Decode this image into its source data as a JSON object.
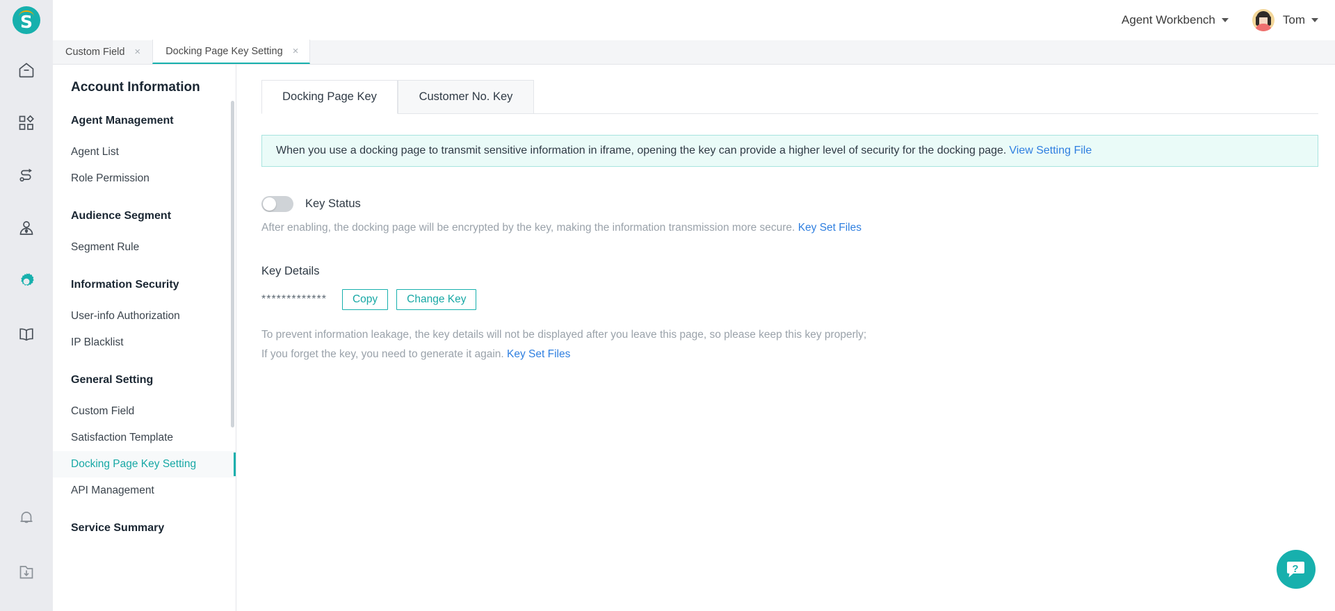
{
  "brand": {
    "logo_letter": "S",
    "accent_color": "#17b0ad",
    "link_color": "#2f7fe0",
    "arc_color": "#f2a900"
  },
  "rail": {
    "icons": [
      {
        "name": "home-icon",
        "active": false
      },
      {
        "name": "apps-grid-icon",
        "active": false
      },
      {
        "name": "workflow-route-icon",
        "active": false
      },
      {
        "name": "customer-profile-icon",
        "active": false
      },
      {
        "name": "gear-settings-icon",
        "active": true
      },
      {
        "name": "knowledge-book-icon",
        "active": false
      }
    ],
    "bottom_icons": [
      {
        "name": "bell-notification-icon"
      },
      {
        "name": "download-folder-icon"
      }
    ]
  },
  "topbar": {
    "workbench_label": "Agent Workbench",
    "user_name": "Tom"
  },
  "window_tabs": [
    {
      "label": "Custom Field",
      "active": false,
      "close": "×"
    },
    {
      "label": "Docking Page Key Setting",
      "active": true,
      "close": "×"
    }
  ],
  "nav": {
    "title": "Account Information",
    "sections": [
      {
        "group": "Agent Management",
        "items": [
          {
            "label": "Agent List",
            "active": false
          },
          {
            "label": "Role Permission",
            "active": false
          }
        ]
      },
      {
        "group": "Audience Segment",
        "items": [
          {
            "label": "Segment Rule",
            "active": false
          }
        ]
      },
      {
        "group": "Information Security",
        "items": [
          {
            "label": "User-info Authorization",
            "active": false
          },
          {
            "label": "IP Blacklist",
            "active": false
          }
        ]
      },
      {
        "group": "General Setting",
        "items": [
          {
            "label": "Custom Field",
            "active": false
          },
          {
            "label": "Satisfaction Template",
            "active": false
          },
          {
            "label": "Docking Page Key Setting",
            "active": true
          },
          {
            "label": "API Management",
            "active": false
          }
        ]
      },
      {
        "group": "Service Summary",
        "items": []
      }
    ]
  },
  "content": {
    "tabs": [
      {
        "label": "Docking Page Key",
        "active": true
      },
      {
        "label": "Customer No. Key",
        "active": false
      }
    ],
    "banner": {
      "text": "When you use a docking page to transmit sensitive information in iframe, opening the key can provide a higher level of security for the docking page.",
      "link_label": "View Setting File"
    },
    "key_status": {
      "label": "Key Status",
      "enabled": false,
      "description": "After enabling, the docking page will be encrypted by the key, making the information transmission more secure.",
      "link_label": "Key Set Files"
    },
    "key_details": {
      "title": "Key Details",
      "masked_value": "*************",
      "copy_label": "Copy",
      "change_label": "Change Key",
      "note_line_1": "To prevent information leakage, the key details will not be displayed after you leave this page, so please keep this key properly;",
      "note_line_2": "If you forget the key, you need to generate it again.",
      "note_link_label": "Key Set Files"
    }
  },
  "help_fab": {
    "glyph": "?",
    "name": "help-chat-button"
  }
}
